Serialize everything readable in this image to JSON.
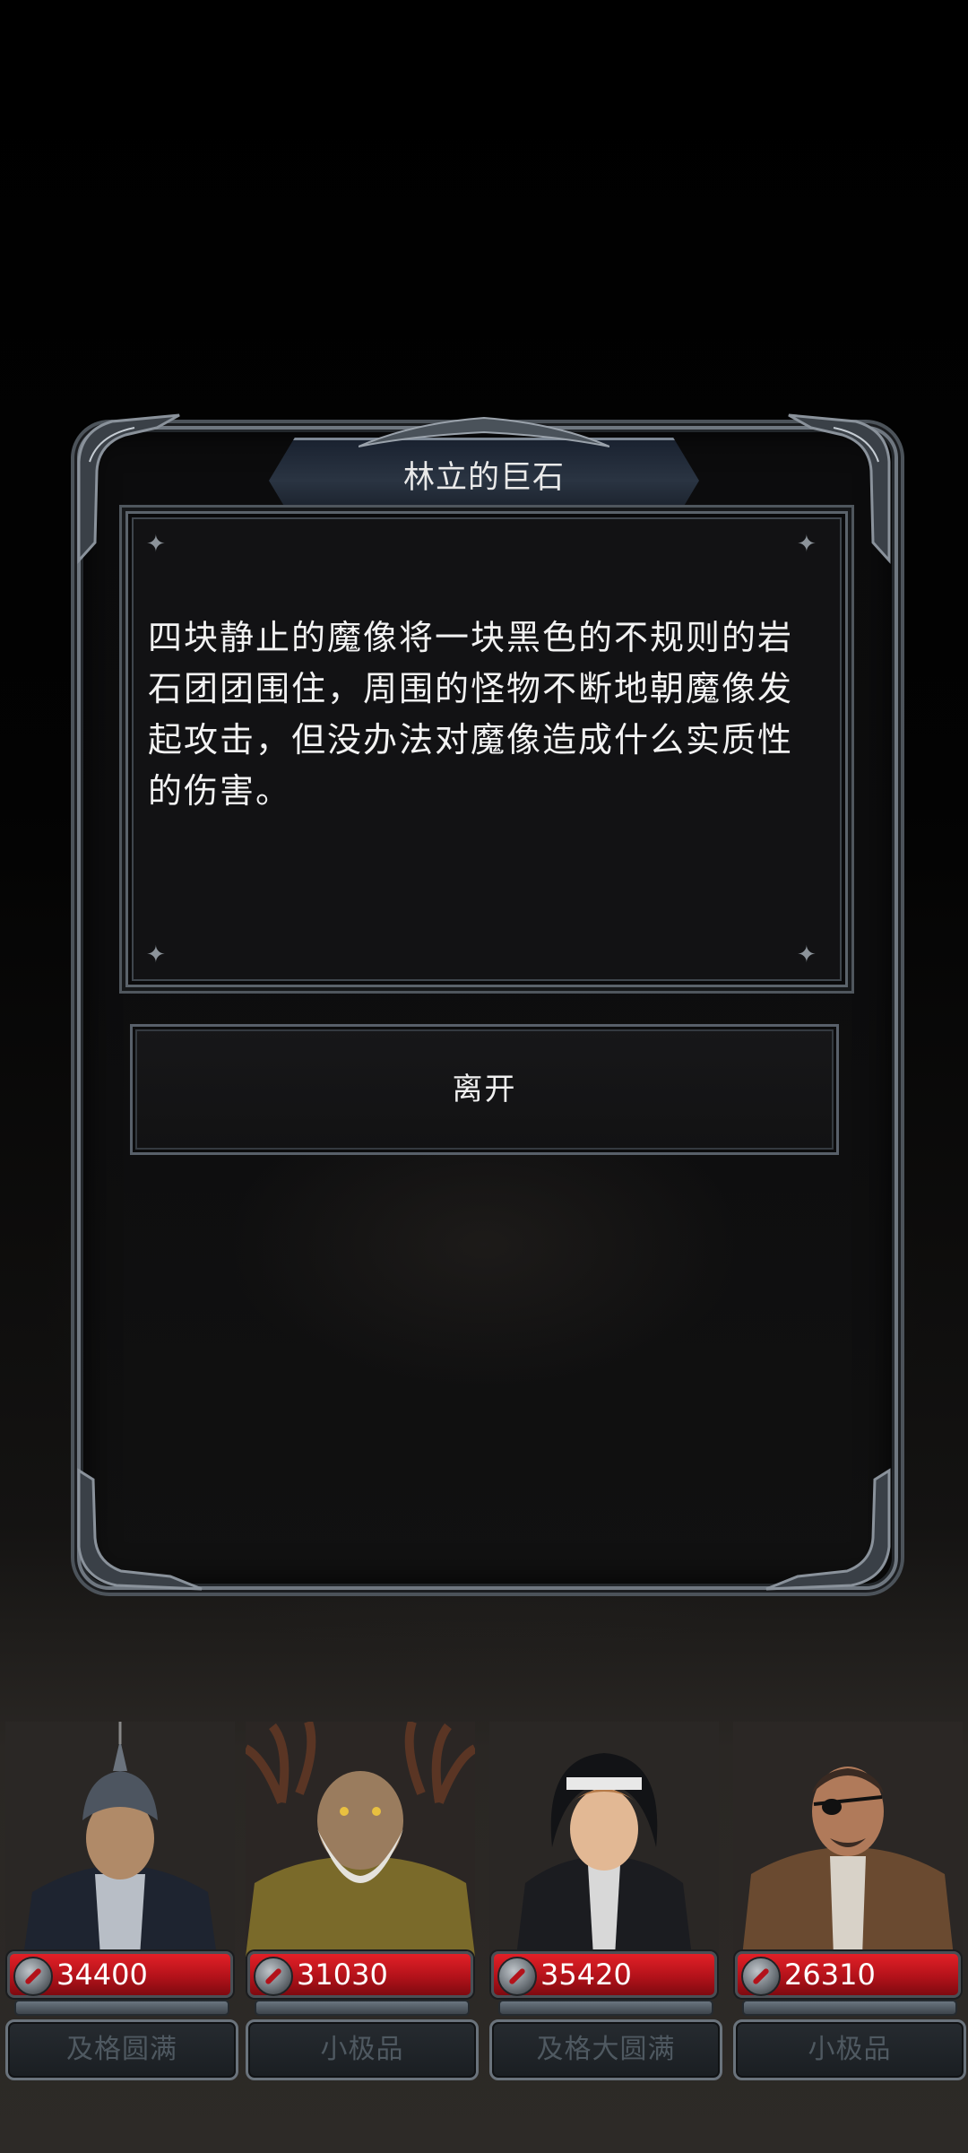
{
  "dialog": {
    "title": "林立的巨石",
    "description_lines": [
      "四块静止的魔像将一块黑色的不规则的岩",
      "石团团围住，周围的怪物不断地朝魔像发",
      "起攻击，但没办法对魔像造成什么实质性",
      "的伤害。"
    ],
    "leave_label": "离开"
  },
  "heroes": [
    {
      "power": "34400",
      "rank": "及格圆满",
      "portrait": "knight-portrait"
    },
    {
      "power": "31030",
      "rank": "小极品",
      "portrait": "antlered-sage-portrait"
    },
    {
      "power": "35420",
      "rank": "及格大圆满",
      "portrait": "nun-portrait"
    },
    {
      "power": "26310",
      "rank": "小极品",
      "portrait": "eyepatch-ranger-portrait"
    }
  ],
  "colors": {
    "frame": "#6f7780",
    "power_bar": "#c4161e",
    "rank_text": "#4f5961"
  }
}
